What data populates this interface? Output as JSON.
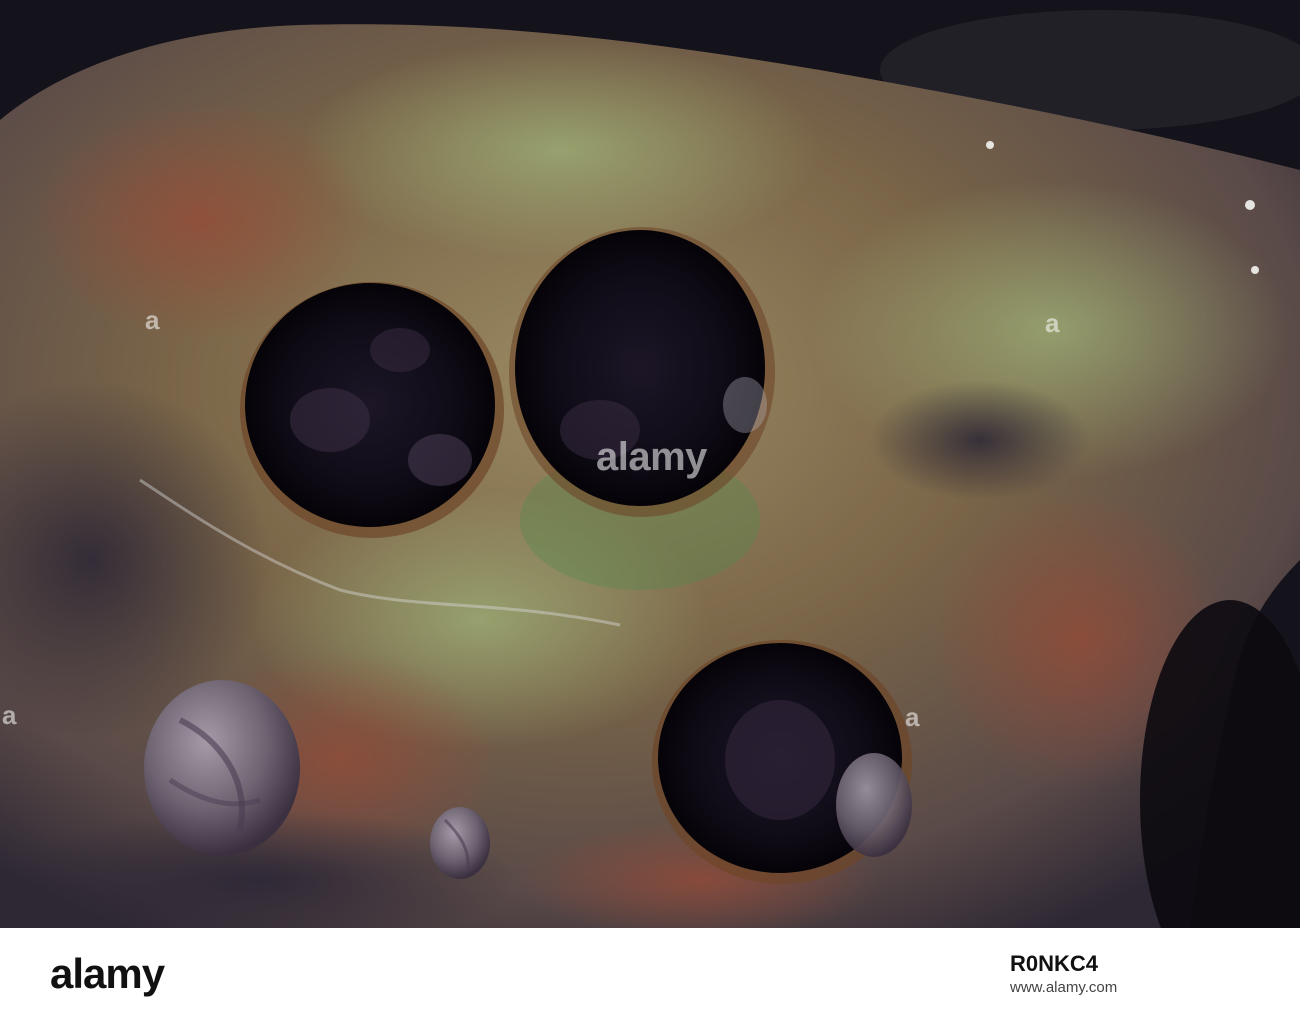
{
  "photo": {
    "subject": "sandstone-rock-with-three-holes-and-periwinkle-snails",
    "watermark_center": "alamy",
    "watermark_side": "a"
  },
  "footer": {
    "logo": "alamy",
    "image_id": "R0NKC4",
    "url": "www.alamy.com"
  },
  "colors": {
    "rock_base": "#7a6548",
    "rock_moss": "#8a9a6a",
    "rock_rust": "#8e4a38",
    "rock_dark": "#3a3342",
    "hole": "#0d0a14",
    "background": "#14121a"
  }
}
